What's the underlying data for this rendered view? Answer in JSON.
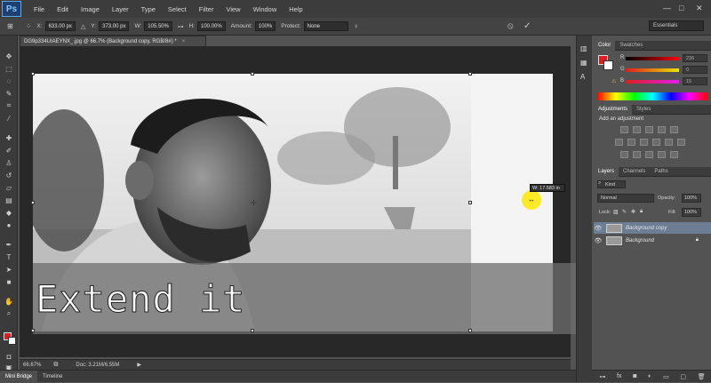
{
  "app": {
    "logo": "Ps",
    "window_controls": [
      "—",
      "□",
      "✕"
    ]
  },
  "menu": [
    "File",
    "Edit",
    "Image",
    "Layer",
    "Type",
    "Select",
    "Filter",
    "View",
    "Window",
    "Help"
  ],
  "options": {
    "x_label": "X:",
    "x_value": "633.00 px",
    "y_label": "Y:",
    "y_value": "373.00 px",
    "w_label": "W:",
    "w_value": "105.50%",
    "h_label": "H:",
    "h_value": "100.00%",
    "amount_label": "Amount:",
    "amount_value": "100%",
    "protect_label": "Protect:",
    "protect_value": "None",
    "workspace": "Essentials"
  },
  "document": {
    "tab_title": "DG9p334UIAEYNX_.jpg @ 66.7% (Background copy, RGB/8#) *",
    "caption": "Extend it",
    "tooltip": "W: 17.583 in"
  },
  "status": {
    "zoom": "66.67%",
    "doc": "Doc: 3.21M/6.55M"
  },
  "bottom_tabs": [
    "Mini Bridge",
    "Timeline"
  ],
  "colors": {
    "accent": "#e11c1c",
    "workspace_bg": "#282828"
  },
  "color_panel": {
    "tabs": [
      "Color",
      "Swatches"
    ],
    "channels": [
      {
        "label": "R",
        "value": "236"
      },
      {
        "label": "G",
        "value": "0"
      },
      {
        "label": "B",
        "value": "15"
      }
    ]
  },
  "adjustments": {
    "tabs": [
      "Adjustments",
      "Styles"
    ],
    "heading": "Add an adjustment"
  },
  "layers": {
    "tabs": [
      "Layers",
      "Channels",
      "Paths"
    ],
    "kind": "Kind",
    "blend_mode": "Normal",
    "opacity_label": "Opacity:",
    "opacity_value": "100%",
    "lock_label": "Lock:",
    "fill_label": "Fill:",
    "fill_value": "100%",
    "items": [
      {
        "name": "Background copy",
        "selected": true
      },
      {
        "name": "Background",
        "selected": false
      }
    ]
  }
}
